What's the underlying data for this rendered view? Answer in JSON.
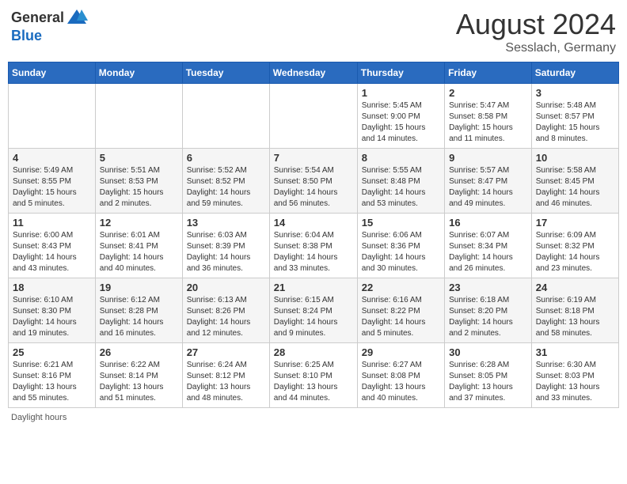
{
  "logo": {
    "general": "General",
    "blue": "Blue"
  },
  "title": {
    "month_year": "August 2024",
    "location": "Sesslach, Germany"
  },
  "weekdays": [
    "Sunday",
    "Monday",
    "Tuesday",
    "Wednesday",
    "Thursday",
    "Friday",
    "Saturday"
  ],
  "weeks": [
    [
      {
        "day": "",
        "info": ""
      },
      {
        "day": "",
        "info": ""
      },
      {
        "day": "",
        "info": ""
      },
      {
        "day": "",
        "info": ""
      },
      {
        "day": "1",
        "info": "Sunrise: 5:45 AM\nSunset: 9:00 PM\nDaylight: 15 hours and 14 minutes."
      },
      {
        "day": "2",
        "info": "Sunrise: 5:47 AM\nSunset: 8:58 PM\nDaylight: 15 hours and 11 minutes."
      },
      {
        "day": "3",
        "info": "Sunrise: 5:48 AM\nSunset: 8:57 PM\nDaylight: 15 hours and 8 minutes."
      }
    ],
    [
      {
        "day": "4",
        "info": "Sunrise: 5:49 AM\nSunset: 8:55 PM\nDaylight: 15 hours and 5 minutes."
      },
      {
        "day": "5",
        "info": "Sunrise: 5:51 AM\nSunset: 8:53 PM\nDaylight: 15 hours and 2 minutes."
      },
      {
        "day": "6",
        "info": "Sunrise: 5:52 AM\nSunset: 8:52 PM\nDaylight: 14 hours and 59 minutes."
      },
      {
        "day": "7",
        "info": "Sunrise: 5:54 AM\nSunset: 8:50 PM\nDaylight: 14 hours and 56 minutes."
      },
      {
        "day": "8",
        "info": "Sunrise: 5:55 AM\nSunset: 8:48 PM\nDaylight: 14 hours and 53 minutes."
      },
      {
        "day": "9",
        "info": "Sunrise: 5:57 AM\nSunset: 8:47 PM\nDaylight: 14 hours and 49 minutes."
      },
      {
        "day": "10",
        "info": "Sunrise: 5:58 AM\nSunset: 8:45 PM\nDaylight: 14 hours and 46 minutes."
      }
    ],
    [
      {
        "day": "11",
        "info": "Sunrise: 6:00 AM\nSunset: 8:43 PM\nDaylight: 14 hours and 43 minutes."
      },
      {
        "day": "12",
        "info": "Sunrise: 6:01 AM\nSunset: 8:41 PM\nDaylight: 14 hours and 40 minutes."
      },
      {
        "day": "13",
        "info": "Sunrise: 6:03 AM\nSunset: 8:39 PM\nDaylight: 14 hours and 36 minutes."
      },
      {
        "day": "14",
        "info": "Sunrise: 6:04 AM\nSunset: 8:38 PM\nDaylight: 14 hours and 33 minutes."
      },
      {
        "day": "15",
        "info": "Sunrise: 6:06 AM\nSunset: 8:36 PM\nDaylight: 14 hours and 30 minutes."
      },
      {
        "day": "16",
        "info": "Sunrise: 6:07 AM\nSunset: 8:34 PM\nDaylight: 14 hours and 26 minutes."
      },
      {
        "day": "17",
        "info": "Sunrise: 6:09 AM\nSunset: 8:32 PM\nDaylight: 14 hours and 23 minutes."
      }
    ],
    [
      {
        "day": "18",
        "info": "Sunrise: 6:10 AM\nSunset: 8:30 PM\nDaylight: 14 hours and 19 minutes."
      },
      {
        "day": "19",
        "info": "Sunrise: 6:12 AM\nSunset: 8:28 PM\nDaylight: 14 hours and 16 minutes."
      },
      {
        "day": "20",
        "info": "Sunrise: 6:13 AM\nSunset: 8:26 PM\nDaylight: 14 hours and 12 minutes."
      },
      {
        "day": "21",
        "info": "Sunrise: 6:15 AM\nSunset: 8:24 PM\nDaylight: 14 hours and 9 minutes."
      },
      {
        "day": "22",
        "info": "Sunrise: 6:16 AM\nSunset: 8:22 PM\nDaylight: 14 hours and 5 minutes."
      },
      {
        "day": "23",
        "info": "Sunrise: 6:18 AM\nSunset: 8:20 PM\nDaylight: 14 hours and 2 minutes."
      },
      {
        "day": "24",
        "info": "Sunrise: 6:19 AM\nSunset: 8:18 PM\nDaylight: 13 hours and 58 minutes."
      }
    ],
    [
      {
        "day": "25",
        "info": "Sunrise: 6:21 AM\nSunset: 8:16 PM\nDaylight: 13 hours and 55 minutes."
      },
      {
        "day": "26",
        "info": "Sunrise: 6:22 AM\nSunset: 8:14 PM\nDaylight: 13 hours and 51 minutes."
      },
      {
        "day": "27",
        "info": "Sunrise: 6:24 AM\nSunset: 8:12 PM\nDaylight: 13 hours and 48 minutes."
      },
      {
        "day": "28",
        "info": "Sunrise: 6:25 AM\nSunset: 8:10 PM\nDaylight: 13 hours and 44 minutes."
      },
      {
        "day": "29",
        "info": "Sunrise: 6:27 AM\nSunset: 8:08 PM\nDaylight: 13 hours and 40 minutes."
      },
      {
        "day": "30",
        "info": "Sunrise: 6:28 AM\nSunset: 8:05 PM\nDaylight: 13 hours and 37 minutes."
      },
      {
        "day": "31",
        "info": "Sunrise: 6:30 AM\nSunset: 8:03 PM\nDaylight: 13 hours and 33 minutes."
      }
    ]
  ],
  "footer": {
    "daylight_label": "Daylight hours"
  }
}
